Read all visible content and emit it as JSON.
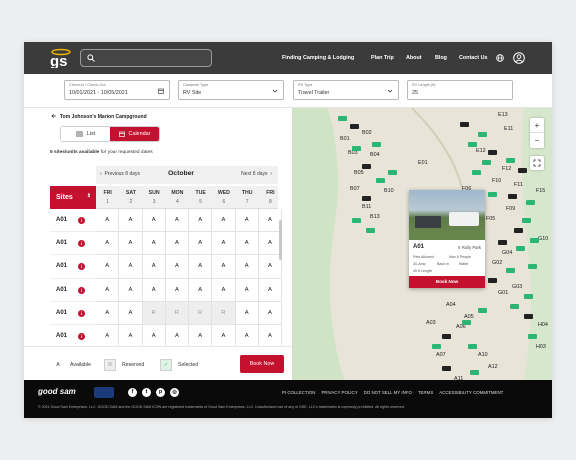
{
  "header": {
    "logo_text": "gs",
    "nav": [
      "Finding Camping & Lodging",
      "Plan Trip",
      "About",
      "Blog",
      "Contact Us"
    ]
  },
  "filters": {
    "dates": {
      "label": "Check-In / Check-Out",
      "value": "10/01/2021 - 10/05/2021"
    },
    "campsite_type": {
      "label": "Campsite Type",
      "value": "RV Site"
    },
    "rv_type": {
      "label": "RV Type",
      "value": "Travel Trailer"
    },
    "rv_length": {
      "label": "RV Length (ft)",
      "value": "25"
    }
  },
  "left": {
    "breadcrumb": "Tom Johnson's Marion Campground",
    "tab_list": "List",
    "tab_calendar": "Calendar",
    "availability_count": "5 sites/units available",
    "availability_rest": " for your requested dates",
    "prev_label": "Previous 8 days",
    "month": "October",
    "next_label": "Next 8 days",
    "sites_label": "Sites",
    "days": [
      {
        "name": "FRI",
        "num": "1"
      },
      {
        "name": "SAT",
        "num": "2"
      },
      {
        "name": "SUN",
        "num": "3"
      },
      {
        "name": "MON",
        "num": "4"
      },
      {
        "name": "TUE",
        "num": "5"
      },
      {
        "name": "WED",
        "num": "6"
      },
      {
        "name": "THU",
        "num": "7"
      },
      {
        "name": "FRI",
        "num": "8"
      }
    ],
    "rows": [
      {
        "site": "A01",
        "cells": [
          "A",
          "A",
          "A",
          "A",
          "A",
          "A",
          "A",
          "A"
        ]
      },
      {
        "site": "A01",
        "cells": [
          "A",
          "A",
          "A",
          "A",
          "A",
          "A",
          "A",
          "A"
        ]
      },
      {
        "site": "A01",
        "cells": [
          "A",
          "A",
          "A",
          "A",
          "A",
          "A",
          "A",
          "A"
        ]
      },
      {
        "site": "A01",
        "cells": [
          "A",
          "A",
          "A",
          "A",
          "A",
          "A",
          "A",
          "A"
        ]
      },
      {
        "site": "A01",
        "cells": [
          "A",
          "A",
          "R",
          "R",
          "R",
          "R",
          "A",
          "A"
        ]
      },
      {
        "site": "A01",
        "cells": [
          "A",
          "A",
          "A",
          "A",
          "A",
          "A",
          "A",
          "A"
        ]
      }
    ]
  },
  "legend": {
    "available_key": "A",
    "available": "Available",
    "reserved_key": "R",
    "reserved": "Reserved",
    "selected_key": "✓",
    "selected": "Selected",
    "book_now": "Book Now"
  },
  "map": {
    "popup": {
      "title": "A01",
      "location": "Roily Park",
      "features": [
        "Pets Allowed",
        "Max 6 People",
        "30-Amp",
        "Back In",
        "Water",
        "40 ft Length"
      ],
      "button": "Book Now"
    },
    "labels": [
      "E13",
      "E11",
      "B01",
      "B02",
      "B03",
      "B04",
      "E01",
      "E12",
      "F12",
      "F10",
      "F06",
      "B05",
      "F11",
      "F15",
      "B07",
      "F07",
      "F09",
      "G10",
      "B10",
      "B11",
      "B13",
      "F05",
      "G04",
      "G02",
      "G03",
      "G01",
      "A04",
      "A05",
      "A06",
      "A03",
      "H04",
      "H03",
      "A07",
      "A10",
      "A12",
      "A11"
    ]
  },
  "footer": {
    "brand": "good sam",
    "links": [
      "PI COLLECTION",
      "PRIVACY POLICY",
      "DO NOT SELL MY INFO",
      "TERMS",
      "ACCESSIBILITY COMMITMENT"
    ],
    "copyright": "© 2021 Good Sam Enterprises, LLC. GOOD SAM and the GOOD SAM ICON are registered trademarks of Good Sam Enterprises, LLC. Unauthorized use of any of GSE, LLC's trademarks is expressly prohibited. All rights reserved."
  },
  "colors": {
    "brand_red": "#c41130",
    "header_bg": "#3b3b3b",
    "footer_bg": "#0a0a0a",
    "map_bg": "#e8e4d8",
    "site_green": "#2bb673"
  }
}
